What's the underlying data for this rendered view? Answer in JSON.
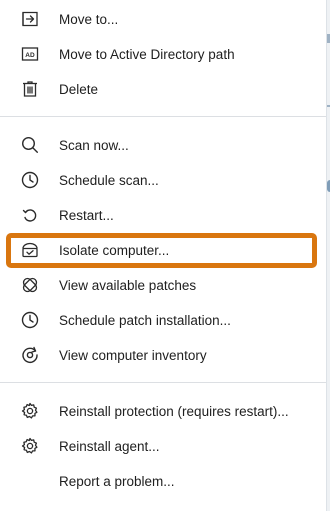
{
  "menu": {
    "items": [
      {
        "label": "Move to...",
        "icon": "move-to-icon"
      },
      {
        "label": "Move to Active Directory path",
        "icon": "active-directory-icon"
      },
      {
        "label": "Delete",
        "icon": "trash-icon"
      },
      {
        "label": "Scan now...",
        "icon": "search-icon"
      },
      {
        "label": "Schedule scan...",
        "icon": "clock-icon"
      },
      {
        "label": "Restart...",
        "icon": "restart-icon"
      },
      {
        "label": "Isolate computer...",
        "icon": "isolate-icon"
      },
      {
        "label": "View available patches",
        "icon": "patch-icon"
      },
      {
        "label": "Schedule patch installation...",
        "icon": "clock-icon"
      },
      {
        "label": "View computer inventory",
        "icon": "inventory-icon"
      },
      {
        "label": "Reinstall protection (requires restart)...",
        "icon": "gear-icon"
      },
      {
        "label": "Reinstall agent...",
        "icon": "gear-icon"
      },
      {
        "label": "Report a problem...",
        "icon": ""
      }
    ],
    "ad_badge": "AD",
    "highlight_color": "#d9760f"
  }
}
